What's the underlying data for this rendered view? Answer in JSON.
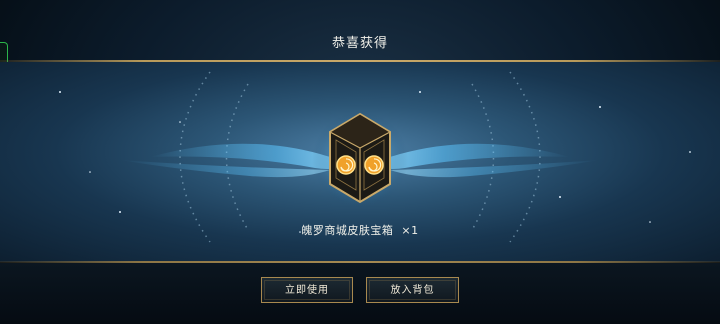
{
  "header": {
    "title": "恭喜获得"
  },
  "reward": {
    "item_name": "魄罗商城皮肤宝箱",
    "quantity": "×1",
    "icon": "skin-chest-icon"
  },
  "actions": {
    "use_now_label": "立即使用",
    "put_in_bag_label": "放入背包"
  },
  "colors": {
    "accent_gold": "#c9a96a",
    "button_border": "#a8894f",
    "side_tab": "#2bb54a",
    "swirl_blue": "#5cc6ff"
  }
}
